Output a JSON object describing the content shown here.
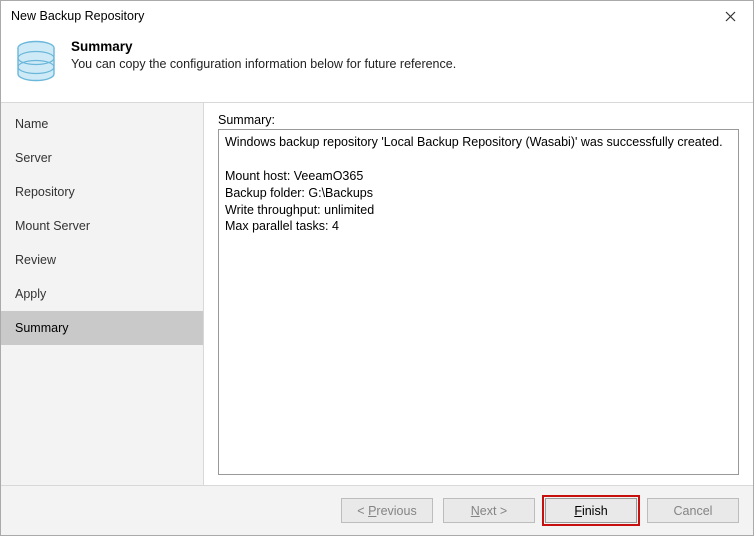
{
  "window": {
    "title": "New Backup Repository"
  },
  "header": {
    "title": "Summary",
    "subtitle": "You can copy the configuration information below for future reference."
  },
  "sidebar": {
    "items": [
      {
        "label": "Name"
      },
      {
        "label": "Server"
      },
      {
        "label": "Repository"
      },
      {
        "label": "Mount Server"
      },
      {
        "label": "Review"
      },
      {
        "label": "Apply"
      },
      {
        "label": "Summary"
      }
    ],
    "selected_index": 6
  },
  "main": {
    "summary_label": "Summary:",
    "summary_text": "Windows backup repository 'Local Backup Repository (Wasabi)' was successfully created.\n\nMount host: VeeamO365\nBackup folder: G:\\Backups\nWrite throughput: unlimited\nMax parallel tasks: 4"
  },
  "footer": {
    "previous": "< Previous",
    "next": "Next >",
    "finish": "Finish",
    "cancel": "Cancel"
  }
}
